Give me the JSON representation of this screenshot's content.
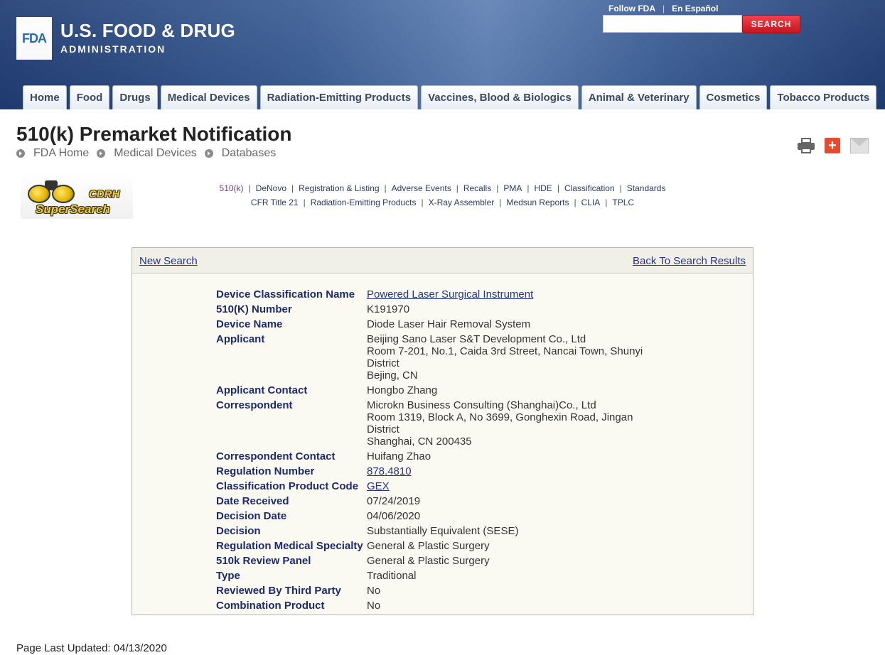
{
  "header": {
    "logo_text": "FDA",
    "agency_line1": "U.S. FOOD & DRUG",
    "agency_line2": "ADMINISTRATION",
    "top_links": [
      "Follow FDA",
      "En Español"
    ],
    "search_button": "SEARCH",
    "search_value": "",
    "nav": [
      "Home",
      "Food",
      "Drugs",
      "Medical Devices",
      "Radiation-Emitting Products",
      "Vaccines, Blood & Biologics",
      "Animal & Veterinary",
      "Cosmetics",
      "Tobacco Products"
    ]
  },
  "page": {
    "title": "510(k) Premarket Notification",
    "breadcrumbs": [
      "FDA Home",
      "Medical Devices",
      "Databases"
    ],
    "tool_icons": [
      "print-icon",
      "add-icon",
      "email-icon"
    ]
  },
  "cdrh_logo": {
    "line1": "CDRH",
    "line2": "SuperSearch"
  },
  "db_links": {
    "row1": [
      "510(k)",
      "DeNovo",
      "Registration & Listing",
      "Adverse Events",
      "Recalls",
      "PMA",
      "HDE",
      "Classification",
      "Standards"
    ],
    "row2": [
      "CFR Title 21",
      "Radiation-Emitting Products",
      "X-Ray Assembler",
      "Medsun Reports",
      "CLIA",
      "TPLC"
    ],
    "current": "510(k)"
  },
  "record": {
    "new_search": "New Search",
    "back_to_results": "Back To Search Results",
    "fields": [
      {
        "label": "Device Classification Name",
        "value": [
          "Powered Laser Surgical Instrument"
        ],
        "link": true
      },
      {
        "label": "510(K) Number",
        "value": [
          "K191970"
        ],
        "link": false
      },
      {
        "label": "Device Name",
        "value": [
          "Diode Laser Hair Removal System"
        ],
        "link": false
      },
      {
        "label": "Applicant",
        "value": [
          "Beijing Sano Laser S&T Development Co., Ltd",
          "Room 7-201, No.1, Caida 3rd Street, Nancai Town, Shunyi District",
          "Bejing,  CN"
        ],
        "link": false
      },
      {
        "label": "Applicant Contact",
        "value": [
          "Hongbo Zhang"
        ],
        "link": false
      },
      {
        "label": "Correspondent",
        "value": [
          "Microkn Business Consulting (Shanghai)Co., Ltd",
          "Room 1319, Block A, No 3699, Gonghexin Road, Jingan District",
          "Shanghai,  CN 200435"
        ],
        "link": false
      },
      {
        "label": "Correspondent Contact",
        "value": [
          "Huifang Zhao"
        ],
        "link": false
      },
      {
        "label": "Regulation Number",
        "value": [
          "878.4810"
        ],
        "link": true
      },
      {
        "label": "Classification Product Code",
        "value": [
          "GEX"
        ],
        "link": true
      },
      {
        "label": "Date Received",
        "value": [
          "07/24/2019"
        ],
        "link": false
      },
      {
        "label": "Decision Date",
        "value": [
          "04/06/2020"
        ],
        "link": false
      },
      {
        "label": "Decision",
        "value": [
          "Substantially Equivalent (SESE)"
        ],
        "link": false
      },
      {
        "label": "Regulation Medical Specialty",
        "value": [
          "General & Plastic Surgery"
        ],
        "link": false
      },
      {
        "label": "510k Review Panel",
        "value": [
          "General & Plastic Surgery"
        ],
        "link": false
      },
      {
        "label": "Type",
        "value": [
          "Traditional"
        ],
        "link": false
      },
      {
        "label": "Reviewed By Third Party",
        "value": [
          "No"
        ],
        "link": false
      },
      {
        "label": "Combination Product",
        "value": [
          "No"
        ],
        "link": false
      }
    ]
  },
  "footer": {
    "last_updated": "Page Last Updated: 04/13/2020"
  },
  "colors": {
    "header_blue": "#3a5d95",
    "search_red": "#d81f28",
    "link_navy": "#25338a",
    "label_navy": "#1d2a6e"
  }
}
